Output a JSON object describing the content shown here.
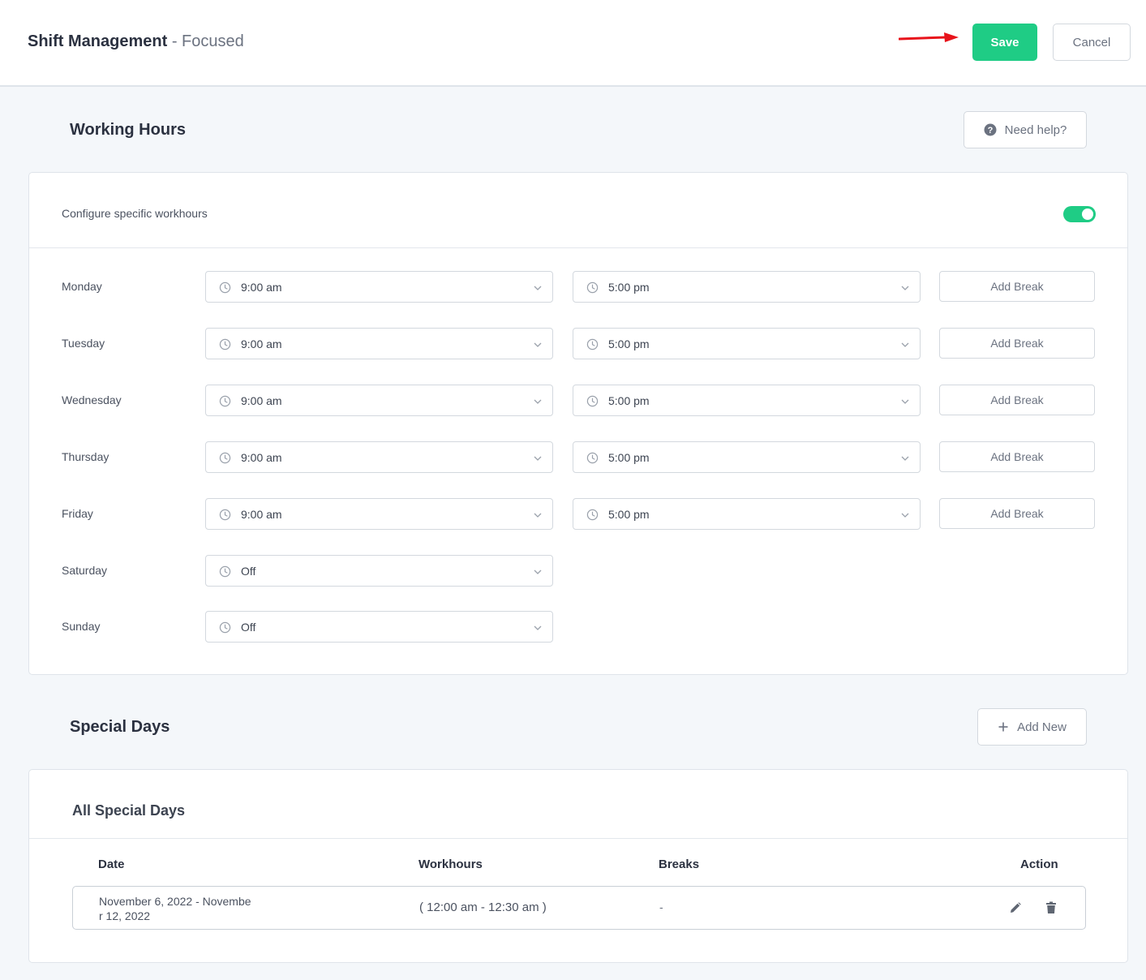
{
  "header": {
    "title": "Shift Management",
    "separator": "-",
    "subtitle": "Focused",
    "save_label": "Save",
    "cancel_label": "Cancel"
  },
  "working_hours": {
    "title": "Working Hours",
    "help_label": "Need help?",
    "configure_label": "Configure specific workhours",
    "toggle_on": true,
    "add_break_label": "Add Break",
    "days": [
      {
        "day": "Monday",
        "start": "9:00 am",
        "end": "5:00 pm"
      },
      {
        "day": "Tuesday",
        "start": "9:00 am",
        "end": "5:00 pm"
      },
      {
        "day": "Wednesday",
        "start": "9:00 am",
        "end": "5:00 pm"
      },
      {
        "day": "Thursday",
        "start": "9:00 am",
        "end": "5:00 pm"
      },
      {
        "day": "Friday",
        "start": "9:00 am",
        "end": "5:00 pm"
      },
      {
        "day": "Saturday",
        "start": "Off"
      },
      {
        "day": "Sunday",
        "start": "Off"
      }
    ]
  },
  "special_days": {
    "title": "Special Days",
    "add_new_label": "Add New",
    "card_title": "All Special Days",
    "columns": [
      "Date",
      "Workhours",
      "Breaks",
      "Action"
    ],
    "rows": [
      {
        "date": "November 6, 2022 - November 12, 2022",
        "workhours": "( 12:00 am - 12:30 am )",
        "breaks": "-"
      }
    ]
  },
  "colors": {
    "accent": "#1fcc85",
    "annotation_arrow": "#e8131b",
    "background": "#f4f7fa"
  },
  "icons": [
    "red-arrow-icon",
    "help-circle-icon",
    "clock-icon",
    "chevron-down-icon",
    "plus-icon",
    "pencil-icon",
    "trash-icon"
  ]
}
